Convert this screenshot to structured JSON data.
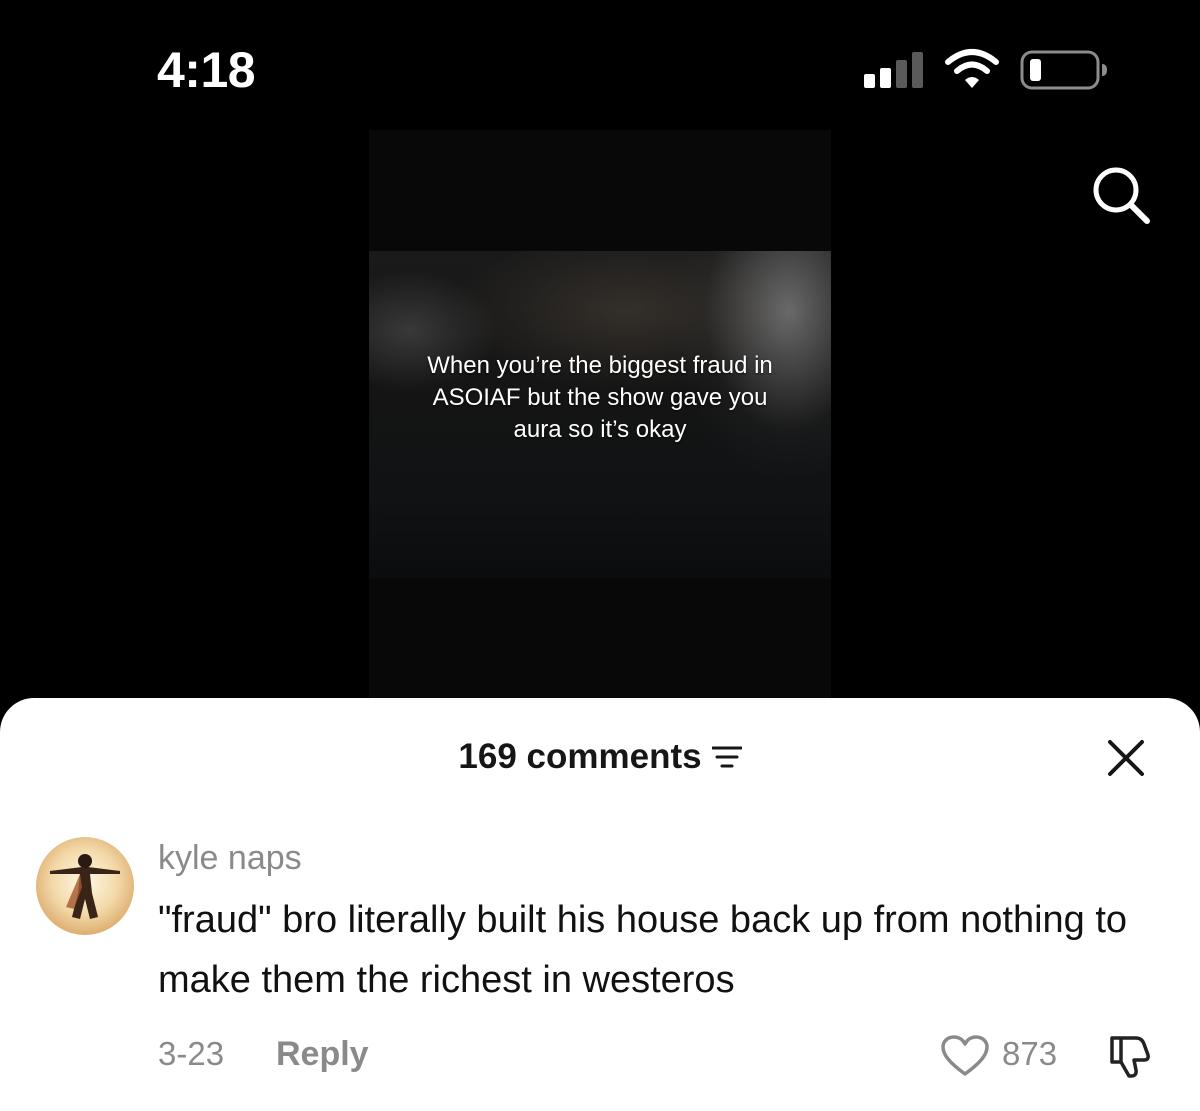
{
  "status_bar": {
    "time": "4:18"
  },
  "video": {
    "caption": "When you’re the biggest fraud in ASOIAF but the show gave you aura so it’s okay"
  },
  "comments_sheet": {
    "count_label": "169 comments",
    "comment": {
      "author": "kyle naps",
      "text": "\"fraud\" bro literally built his house back up from nothing to make them the richest in westeros",
      "date": "3-23",
      "reply_label": "Reply",
      "like_count": "873"
    }
  },
  "icons": {
    "status": [
      "signal-icon",
      "wifi-icon",
      "battery-icon"
    ],
    "search": "search-icon",
    "filter": "filter-icon",
    "close": "close-icon",
    "like": "heart-icon",
    "dislike": "thumbs-down-icon"
  },
  "colors": {
    "background": "#000000",
    "sheet": "#ffffff",
    "muted_text": "#8a8a8a",
    "primary_text": "#161616"
  }
}
